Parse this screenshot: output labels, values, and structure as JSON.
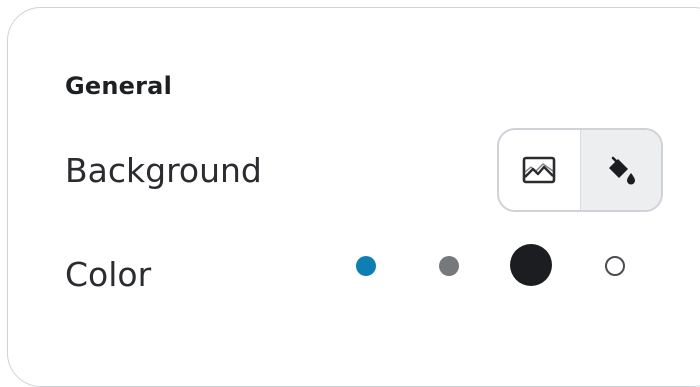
{
  "section": {
    "title": "General"
  },
  "background": {
    "label": "Background",
    "options": [
      {
        "icon": "image-icon",
        "selected": false
      },
      {
        "icon": "paint-bucket-icon",
        "selected": true
      }
    ]
  },
  "color": {
    "label": "Color",
    "swatches": [
      {
        "color": "#0e7fb2",
        "selected": false
      },
      {
        "color": "#76797c",
        "selected": false
      },
      {
        "color": "#1b1d20",
        "selected": true
      },
      {
        "color": "#ffffff",
        "selected": false
      }
    ]
  }
}
